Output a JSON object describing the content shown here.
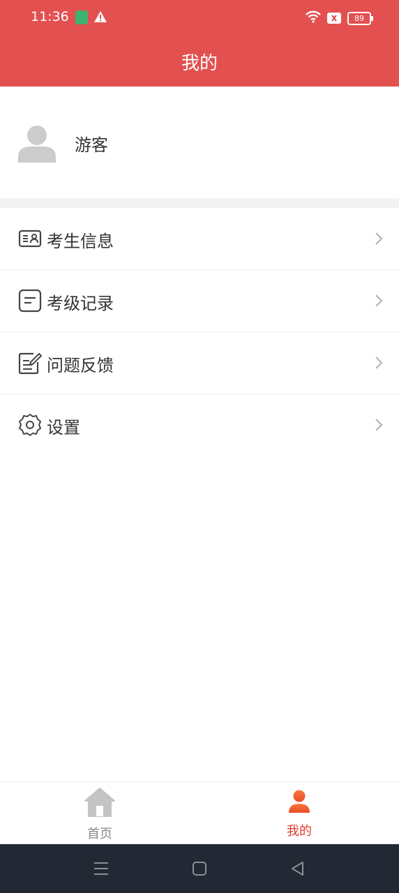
{
  "status_bar": {
    "time": "11:36",
    "battery": "89",
    "icons": [
      "app-notification-icon",
      "warning-icon",
      "wifi-icon",
      "no-sim-icon",
      "battery-icon"
    ]
  },
  "header": {
    "title": "我的"
  },
  "profile": {
    "name": "游客",
    "avatar_icon": "user-avatar-icon"
  },
  "menu": {
    "items": [
      {
        "label": "考生信息",
        "icon": "id-card-icon"
      },
      {
        "label": "考级记录",
        "icon": "record-list-icon"
      },
      {
        "label": "问题反馈",
        "icon": "feedback-edit-icon"
      },
      {
        "label": "设置",
        "icon": "gear-icon"
      }
    ]
  },
  "tab_bar": {
    "tabs": [
      {
        "label": "首页",
        "icon": "home-icon",
        "active": false
      },
      {
        "label": "我的",
        "icon": "person-icon",
        "active": true
      }
    ]
  },
  "colors": {
    "header_bg": "#e35050",
    "active_tab": "#e03a2c",
    "inactive_tab": "#888888",
    "nav_bar_bg": "#222834"
  }
}
